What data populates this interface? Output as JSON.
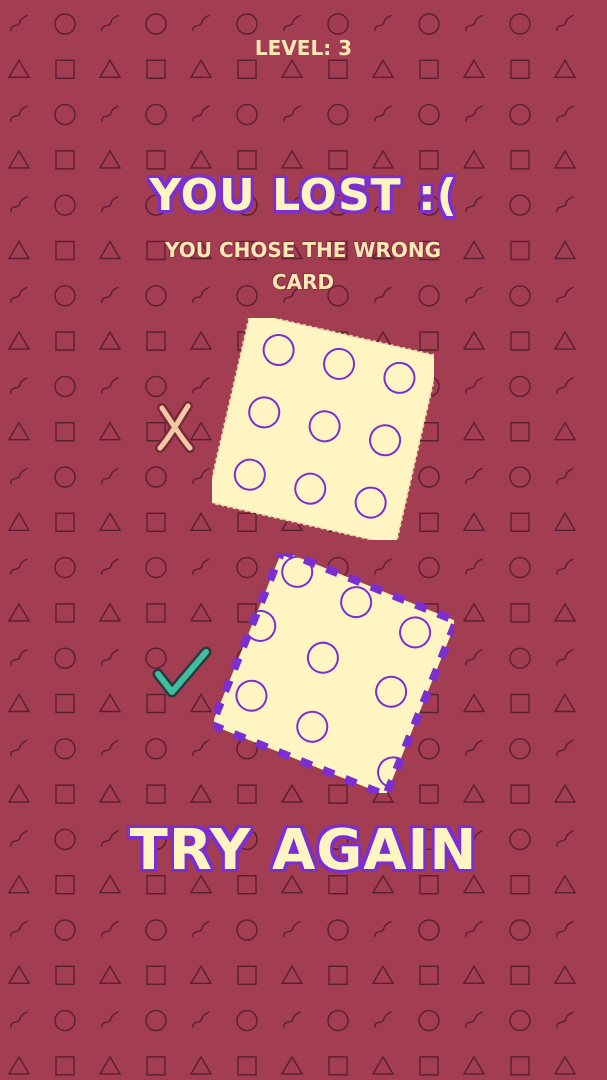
{
  "header": {
    "level_label": "LEVEL: 3"
  },
  "result": {
    "title": "YOU LOST :(",
    "subtitle": "YOU CHOSE THE WRONG CARD"
  },
  "cards": {
    "chosen": {
      "shape": "circle",
      "count": 9,
      "icon": "x-mark-icon"
    },
    "correct": {
      "shape": "circle",
      "count": 9,
      "icon": "checkmark-icon"
    }
  },
  "actions": {
    "try_again_label": "TRY AGAIN"
  },
  "colors": {
    "background": "#a33d52",
    "pattern": "#5a1f30",
    "card": "#fff5c2",
    "accent": "#7b2fd0",
    "check": "#3fbfa0"
  }
}
